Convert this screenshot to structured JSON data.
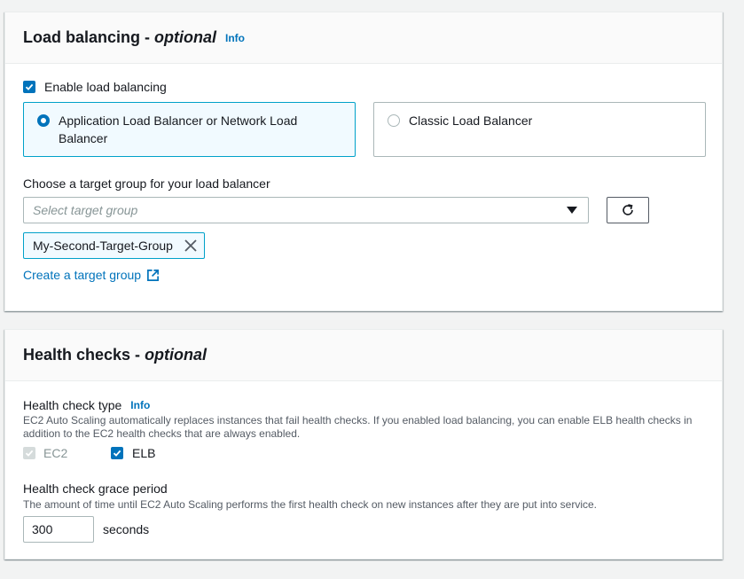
{
  "load_balancing": {
    "title": "Load balancing - ",
    "title_optional": "optional",
    "info": "Info",
    "enable_label": "Enable load balancing",
    "enable_checked": true,
    "option_alb_nlb": "Application Load Balancer or Network Load Balancer",
    "option_classic": "Classic Load Balancer",
    "selected_option": "alb_nlb",
    "target_group_label": "Choose a target group for your load balancer",
    "target_group_placeholder": "Select target group",
    "selected_target_group": "My-Second-Target-Group",
    "create_link": "Create a target group"
  },
  "health_checks": {
    "title": "Health checks - ",
    "title_optional": "optional",
    "type_label": "Health check type",
    "info": "Info",
    "type_description": "EC2 Auto Scaling automatically replaces instances that fail health checks. If you enabled load balancing, you can enable ELB health checks in addition to the EC2 health checks that are always enabled.",
    "ec2_label": "EC2",
    "elb_label": "ELB",
    "grace_label": "Health check grace period",
    "grace_description": "The amount of time until EC2 Auto Scaling performs the first health check on new instances after they are put into service.",
    "grace_value": "300",
    "grace_unit": "seconds"
  },
  "colors": {
    "accent": "#0073bb",
    "selected_border": "#00a1c9",
    "selected_bg": "#f1faff"
  }
}
